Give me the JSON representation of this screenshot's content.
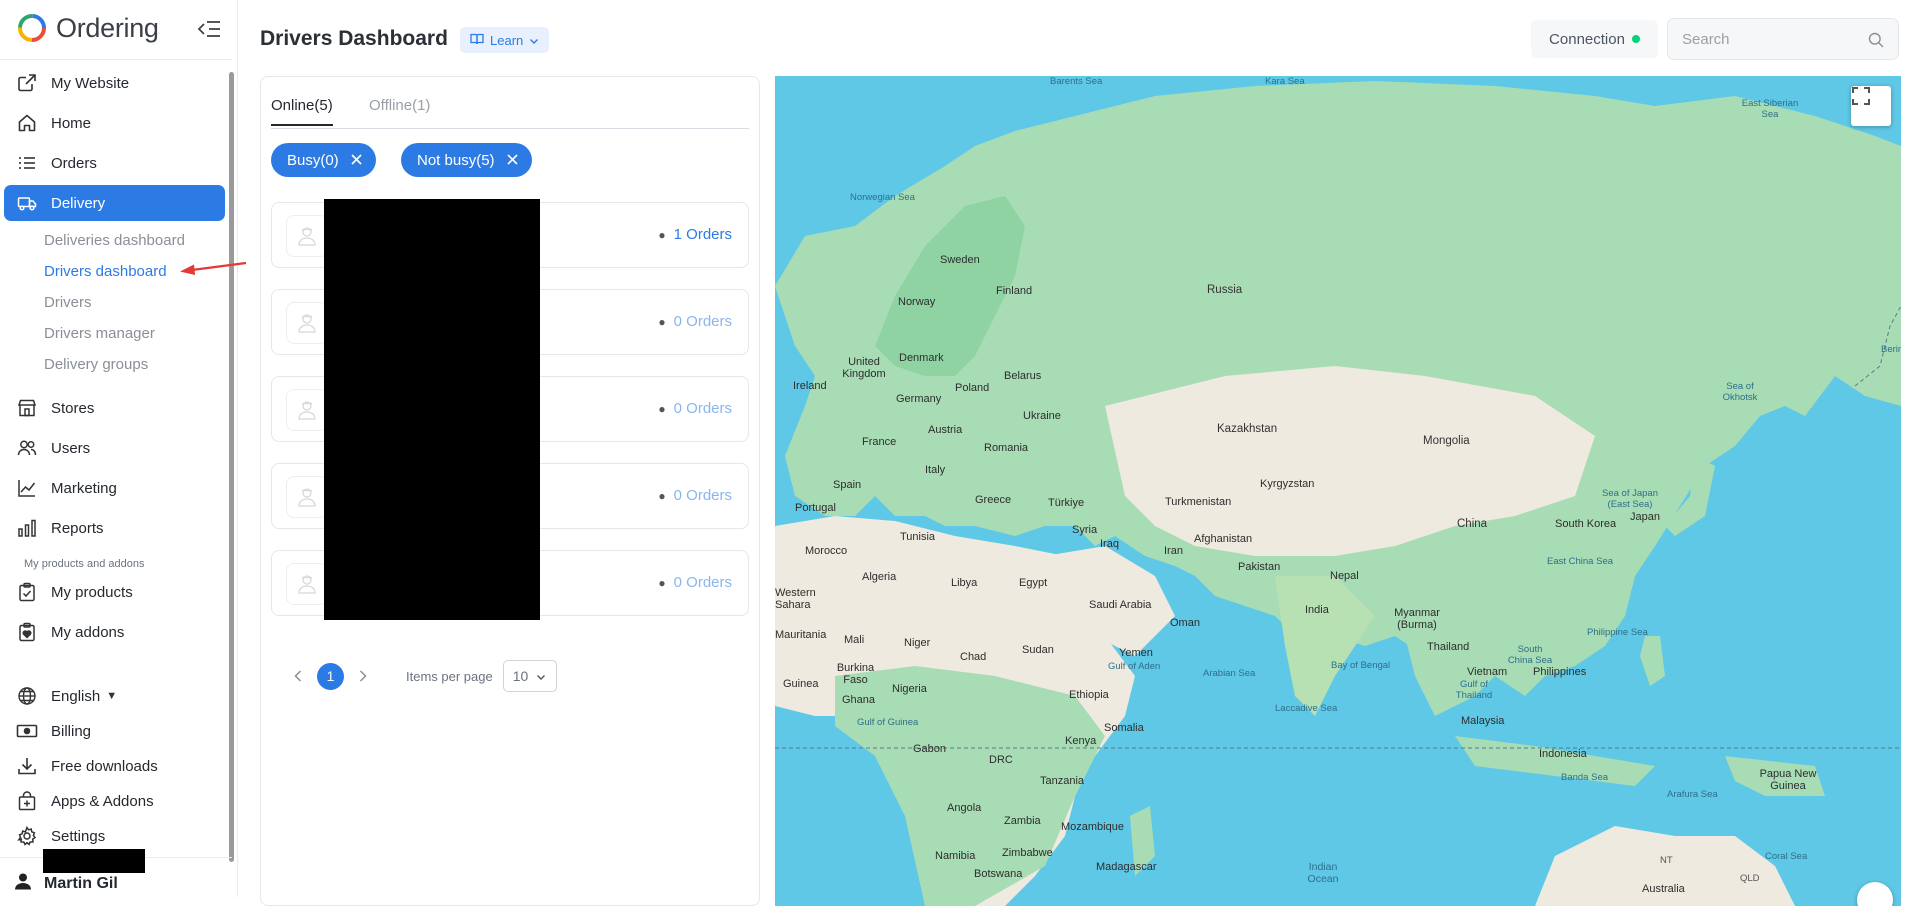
{
  "brand": {
    "name": "Ordering"
  },
  "sidebar": {
    "items": [
      {
        "label": "My Website",
        "icon": "external-link-icon"
      },
      {
        "label": "Home",
        "icon": "home-icon"
      },
      {
        "label": "Orders",
        "icon": "list-icon"
      },
      {
        "label": "Delivery",
        "icon": "truck-icon",
        "active": true
      },
      {
        "label": "Stores",
        "icon": "store-icon"
      },
      {
        "label": "Users",
        "icon": "users-icon"
      },
      {
        "label": "Marketing",
        "icon": "chart-line-icon"
      },
      {
        "label": "Reports",
        "icon": "bar-chart-icon"
      },
      {
        "label": "My products",
        "icon": "clipboard-check-icon"
      },
      {
        "label": "My addons",
        "icon": "clipboard-heart-icon"
      },
      {
        "label": "English",
        "icon": "globe-icon"
      },
      {
        "label": "Billing",
        "icon": "cash-icon"
      },
      {
        "label": "Free downloads",
        "icon": "download-icon"
      },
      {
        "label": "Apps & Addons",
        "icon": "bag-plus-icon"
      },
      {
        "label": "Settings",
        "icon": "gear-icon"
      }
    ],
    "delivery_sub": [
      {
        "label": "Deliveries dashboard"
      },
      {
        "label": "Drivers dashboard",
        "active": true
      },
      {
        "label": "Drivers"
      },
      {
        "label": "Drivers manager"
      },
      {
        "label": "Delivery groups"
      }
    ],
    "section_label": "My products and addons",
    "user_name": "Martin Gil"
  },
  "header": {
    "title": "Drivers Dashboard",
    "learn_label": "Learn",
    "connection_label": "Connection",
    "connection_color": "#00d27a",
    "search_placeholder": "Search"
  },
  "drivers": {
    "tabs": [
      {
        "label": "Online(5)"
      },
      {
        "label": "Offline(1)"
      }
    ],
    "filters": [
      {
        "label": "Busy(0)"
      },
      {
        "label": "Not busy(5)"
      }
    ],
    "list": [
      {
        "orders": "1 Orders"
      },
      {
        "orders": "0 Orders"
      },
      {
        "orders": "0 Orders"
      },
      {
        "orders": "0 Orders"
      },
      {
        "orders": "0 Orders"
      }
    ],
    "pagination": {
      "current_page": "1",
      "items_per_page_label": "Items per page",
      "items_per_page": "10"
    }
  },
  "map": {
    "labels": {
      "seas": [
        "Barents Sea",
        "Kara Sea",
        "East Siberian Sea",
        "Norwegian Sea",
        "Sea of Okhotsk",
        "Sea of Japan (East Sea)",
        "East China Sea",
        "Philippine Sea",
        "South China Sea",
        "Gulf of Thailand",
        "Bay of Bengal",
        "Arabian Sea",
        "Gulf of Aden",
        "Laccadive Sea",
        "Gulf of Guinea",
        "Banda Sea",
        "Arafura Sea",
        "Coral Sea",
        "Indian Ocean",
        "Berin"
      ],
      "places": [
        "Sweden",
        "Finland",
        "Norway",
        "Russia",
        "Denmark",
        "United Kingdom",
        "Ireland",
        "Belarus",
        "Poland",
        "Germany",
        "Ukraine",
        "France",
        "Austria",
        "Romania",
        "Italy",
        "Kazakhstan",
        "Mongolia",
        "Spain",
        "Portugal",
        "Greece",
        "Türkiye",
        "Turkmenistan",
        "Kyrgyzstan",
        "Tunisia",
        "Syria",
        "Iraq",
        "Afghanistan",
        "Iran",
        "Morocco",
        "Algeria",
        "Libya",
        "Egypt",
        "Pakistan",
        "Nepal",
        "China",
        "South Korea",
        "Japan",
        "Western Sahara",
        "Saudi Arabia",
        "India",
        "Myanmar (Burma)",
        "Mauritania",
        "Mali",
        "Niger",
        "Chad",
        "Sudan",
        "Oman",
        "Yemen",
        "Thailand",
        "Vietnam",
        "Philippines",
        "Burkina Faso",
        "Guinea",
        "Ghana",
        "Nigeria",
        "Ethiopia",
        "Somalia",
        "Malaysia",
        "Gabon",
        "DRC",
        "Kenya",
        "Tanzania",
        "Indonesia",
        "Papua New Guinea",
        "Angola",
        "Zambia",
        "Mozambique",
        "Namibia",
        "Zimbabwe",
        "Botswana",
        "Madagascar",
        "Australia",
        "NT",
        "QLD"
      ]
    }
  }
}
